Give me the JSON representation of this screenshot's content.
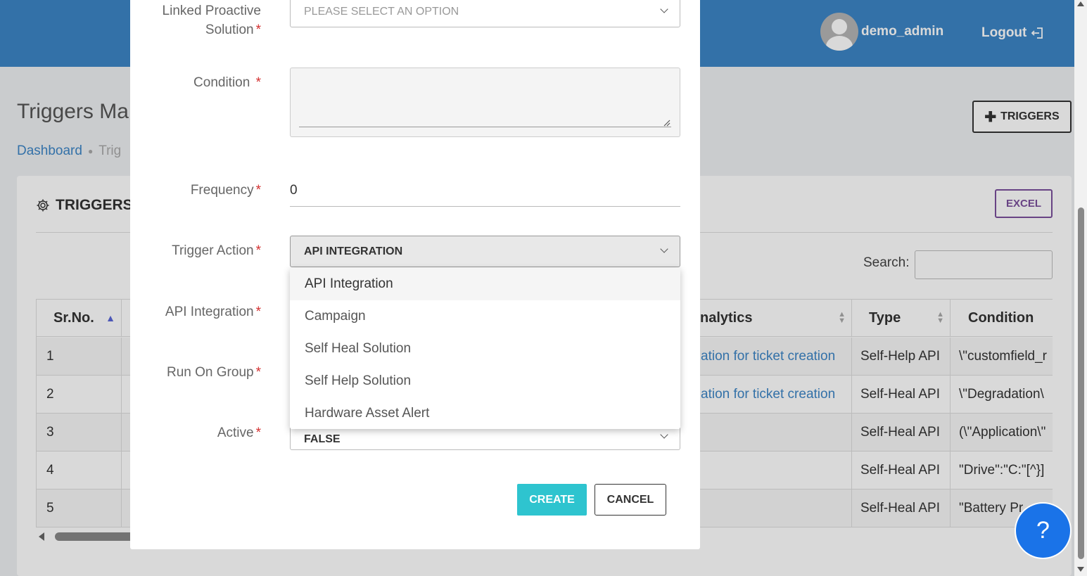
{
  "header": {
    "username": "demo_admin",
    "logout_label": "Logout"
  },
  "page": {
    "title": "Triggers Ma",
    "breadcrumb": [
      "Dashboard",
      "Trig"
    ],
    "add_button": "TRIGGERS"
  },
  "card": {
    "title": "TRIGGERS",
    "excel_label": "EXCEL",
    "search_label": "Search:"
  },
  "table": {
    "columns": [
      "Sr.No.",
      "nalytics",
      "Type",
      "Condition"
    ],
    "rows": [
      {
        "srno": "1",
        "analytics": "ation for ticket creation",
        "type": "Self-Help API",
        "condition": "\\\"customfield_r"
      },
      {
        "srno": "2",
        "analytics": "ation for ticket creation",
        "type": "Self-Heal API",
        "condition": "\\\"Degradation\\"
      },
      {
        "srno": "3",
        "analytics": "",
        "type": "Self-Heal API",
        "condition": "(\\\"Application\\\""
      },
      {
        "srno": "4",
        "analytics": "",
        "type": "Self-Heal API",
        "condition": "\"Drive\":\"C:\"[^}]"
      },
      {
        "srno": "5",
        "analytics": "",
        "type": "Self-Heal API",
        "condition": "\"Battery Pr"
      }
    ]
  },
  "modal": {
    "fields": {
      "linked_solution_label_1": "Linked Proactive",
      "linked_solution_label_2": "Solution",
      "linked_solution_placeholder": "PLEASE SELECT AN OPTION",
      "condition_label": "Condition",
      "frequency_label": "Frequency",
      "frequency_value": "0",
      "trigger_action_label": "Trigger Action",
      "trigger_action_value": "API INTEGRATION",
      "api_integration_label": "API Integration",
      "run_on_group_label": "Run On Group",
      "active_label": "Active",
      "active_value": "FALSE"
    },
    "dropdown_options": [
      "API Integration",
      "Campaign",
      "Self Heal Solution",
      "Self Help Solution",
      "Hardware Asset Alert"
    ],
    "create_label": "CREATE",
    "cancel_label": "CANCEL"
  },
  "help_label": "?",
  "colors": {
    "header_blue": "#3d85c6",
    "create_teal": "#2ec4cf",
    "excel_purple": "#7b4f9c",
    "required_red": "#d32f2f",
    "help_blue": "#1a73e8"
  }
}
